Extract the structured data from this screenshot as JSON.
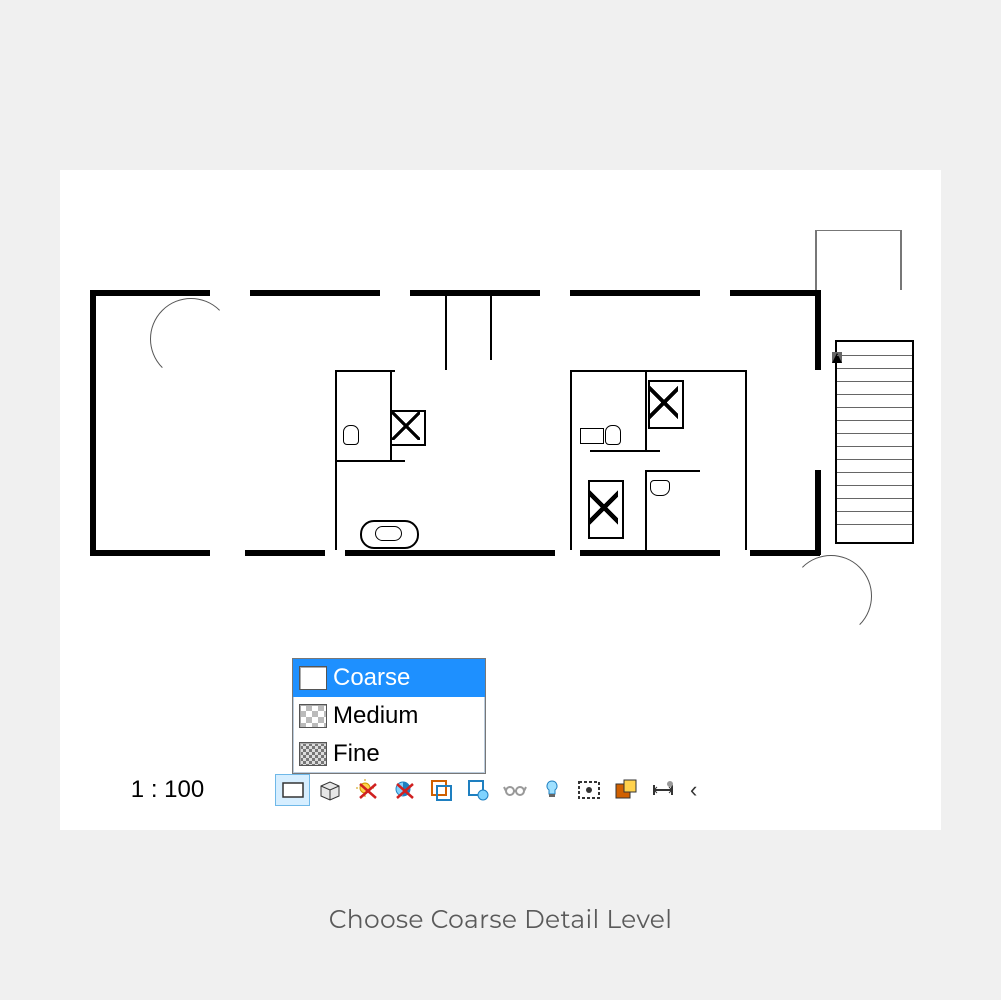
{
  "viewbar": {
    "scale_label": "1 : 100",
    "collapse_glyph": "‹"
  },
  "detail_popup": {
    "options": [
      {
        "label": "Coarse",
        "selected": true,
        "swatch": "coarse"
      },
      {
        "label": "Medium",
        "selected": false,
        "swatch": "medium"
      },
      {
        "label": "Fine",
        "selected": false,
        "swatch": "fine"
      }
    ]
  },
  "toolbar_icons": [
    {
      "name": "detail-level-icon",
      "active": true
    },
    {
      "name": "visual-style-icon"
    },
    {
      "name": "sun-path-off-icon"
    },
    {
      "name": "shadows-off-icon"
    },
    {
      "name": "crop-view-icon"
    },
    {
      "name": "show-crop-region-icon"
    },
    {
      "name": "glasses-icon"
    },
    {
      "name": "light-bulb-icon"
    },
    {
      "name": "temporary-hide-icon"
    },
    {
      "name": "reveal-hidden-icon"
    },
    {
      "name": "dimension-icon"
    }
  ],
  "caption": "Choose Coarse Detail Level"
}
